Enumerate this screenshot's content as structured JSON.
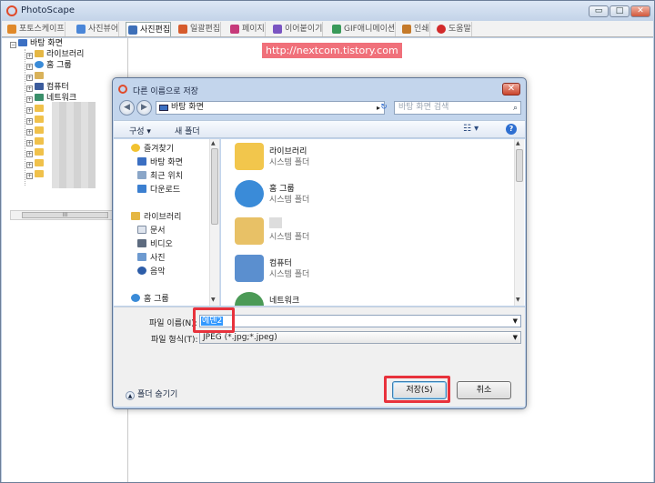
{
  "app": {
    "title": "PhotoScape",
    "min": "▭",
    "max": "□",
    "close": "✕"
  },
  "tabs": [
    {
      "label": "포토스케이프",
      "color": "#e0892a"
    },
    {
      "label": "사진뷰어",
      "color": "#4a86d8"
    },
    {
      "label": "사진편집",
      "color": "#3d6fb8"
    },
    {
      "label": "일괄편집",
      "color": "#d65b2c"
    },
    {
      "label": "페이지",
      "color": "#c63a7a"
    },
    {
      "label": "이어붙이기",
      "color": "#7a55c2"
    },
    {
      "label": "GIF애니메이션",
      "color": "#3a9a5a"
    },
    {
      "label": "인쇄",
      "color": "#c57a2a"
    },
    {
      "label": "도움말",
      "color": "#d22a2a"
    }
  ],
  "tree": {
    "root": "바탕 화면",
    "items": [
      "라이브러리",
      "홈 그룹",
      "",
      "컴퓨터",
      "네트워크"
    ],
    "scroll_thumb": "III"
  },
  "banner": "http://nextcom.tistory.com",
  "dialog": {
    "title": "다른 이름으로 저장",
    "close": "✕",
    "back": "◀",
    "forward": "▶",
    "address": "바탕 화면",
    "address_arrow": "▸",
    "refresh": "↻",
    "search_placeholder": "바탕 화면 검색",
    "search_icon": "⌕",
    "organize": "구성 ▾",
    "new_folder": "새 폴더",
    "view_icon": "☷ ▾",
    "help": "?",
    "nav": {
      "favorites": "즐겨찾기",
      "favorites_items": [
        "바탕 화면",
        "최근 위치",
        "다운로드"
      ],
      "libraries": "라이브러리",
      "library_items": [
        "문서",
        "비디오",
        "사진",
        "음악"
      ],
      "homegroup": "홈 그룹"
    },
    "files": [
      {
        "name": "라이브러리",
        "type": "시스템 폴더",
        "icon": "library-folder-icon",
        "color": "#f2c64c"
      },
      {
        "name": "홈 그룹",
        "type": "시스템 폴더",
        "icon": "homegroup-icon",
        "color": "#3a8bd8"
      },
      {
        "name": "",
        "type": "시스템 폴더",
        "icon": "user-folder-icon",
        "color": "#e8c166"
      },
      {
        "name": "컴퓨터",
        "type": "시스템 폴더",
        "icon": "computer-icon",
        "color": "#5b8fcf"
      },
      {
        "name": "네트워크",
        "type": "",
        "icon": "network-icon",
        "color": "#4b9a56"
      }
    ],
    "filename_label": "파일 이름(N):",
    "filename_value": "에덴2",
    "filetype_label": "파일 형식(T):",
    "filetype_value": "JPEG (*.jpg;*.jpeg)",
    "hide_folders": "폴더 숨기기",
    "save": "저장(S)",
    "cancel": "취소"
  },
  "colors": {
    "highlight": "#e8323c",
    "banner": "#f0707a",
    "selection": "#3399ff"
  }
}
